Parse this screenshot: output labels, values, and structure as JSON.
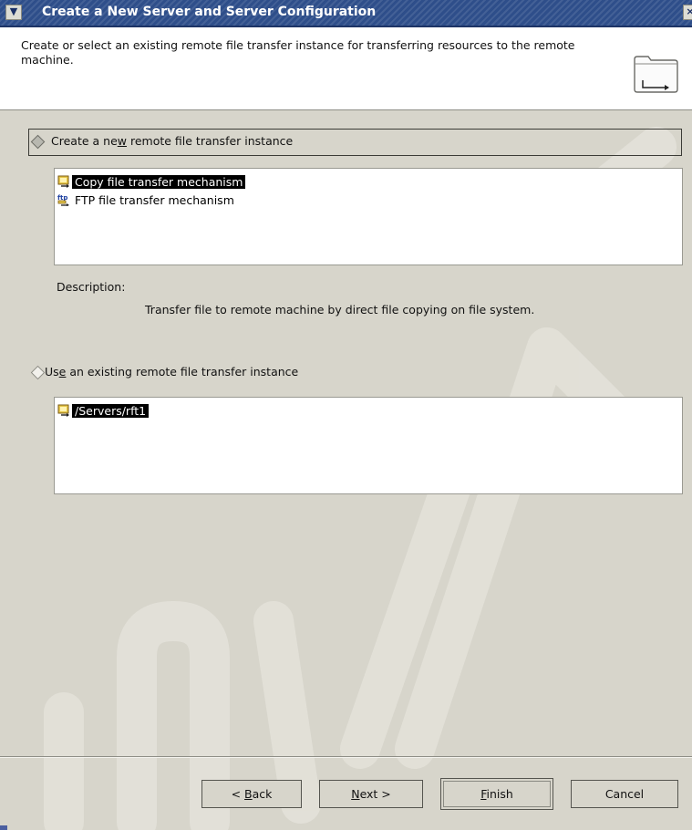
{
  "window": {
    "title": "Create a New Server and Server Configuration",
    "menu_glyph": "✔",
    "close_glyph": "×"
  },
  "header": {
    "description": "Create or select an existing remote file transfer instance for transferring resources to the remote machine.",
    "icon": "folder-transfer-icon"
  },
  "create_new": {
    "label_pre": "Create a ne",
    "label_mnemonic": "w",
    "label_post": " remote file transfer instance",
    "selected": true,
    "mechanisms": [
      {
        "label": "Copy file transfer mechanism",
        "icon": "copy-transfer-icon",
        "selected": true
      },
      {
        "label": "FTP file transfer mechanism",
        "icon": "ftp-transfer-icon",
        "selected": false
      }
    ],
    "description_label": "Description:",
    "description_text": "Transfer file to remote machine by direct file copying on file system."
  },
  "use_existing": {
    "label_pre": "Us",
    "label_mnemonic": "e",
    "label_post": " an existing remote file transfer instance",
    "selected": false,
    "instances": [
      {
        "label": "/Servers/rft1",
        "icon": "copy-transfer-icon",
        "selected": true
      }
    ]
  },
  "buttons": {
    "back_pre": "< ",
    "back_mnemonic": "B",
    "back_post": "ack",
    "next_mnemonic": "N",
    "next_post": "ext >",
    "finish_mnemonic": "F",
    "finish_post": "inish",
    "cancel": "Cancel"
  },
  "colors": {
    "titlebar": "#2e4e8a",
    "dialog_bg": "#d7d5cb",
    "selection": "#000000"
  }
}
